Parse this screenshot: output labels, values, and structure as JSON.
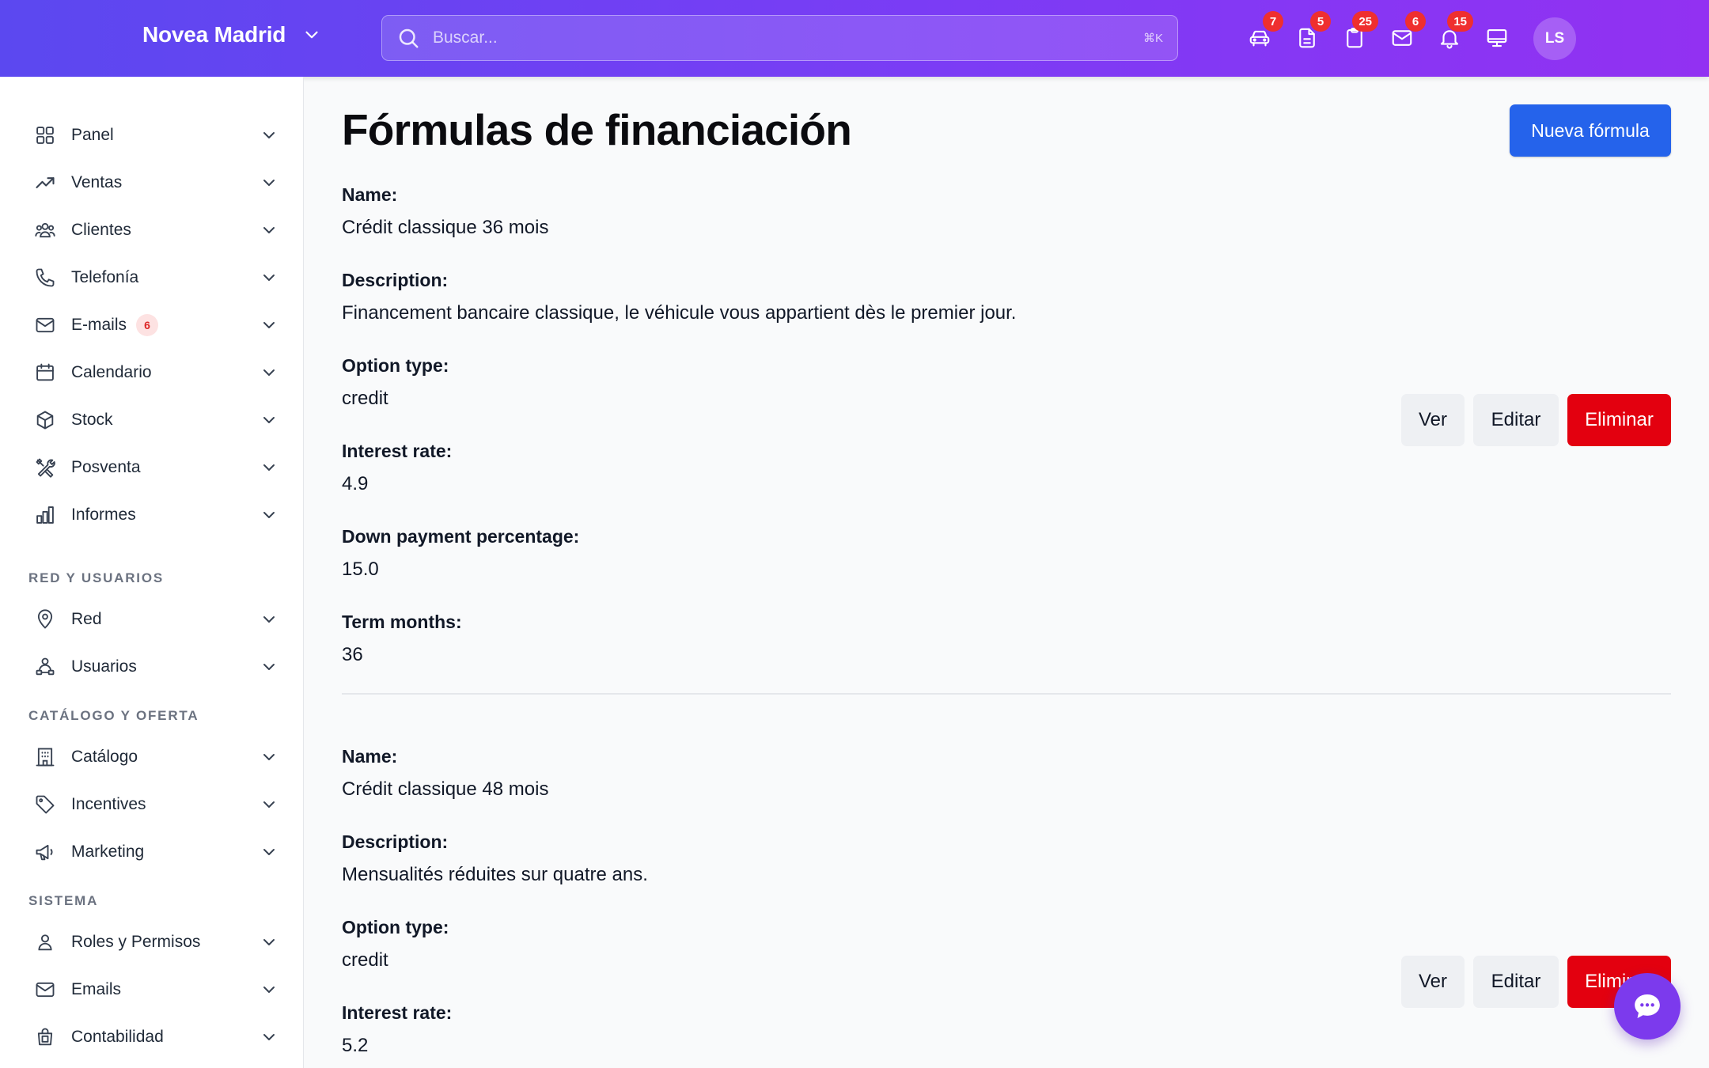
{
  "header": {
    "brand": "Novea Madrid",
    "search_placeholder": "Buscar...",
    "search_shortcut": "⌘K",
    "icons": [
      {
        "name": "car-icon",
        "badge": "7"
      },
      {
        "name": "document-icon",
        "badge": "5"
      },
      {
        "name": "clipboard-icon",
        "badge": "25"
      },
      {
        "name": "mail-icon",
        "badge": "6"
      },
      {
        "name": "bell-icon",
        "badge": "15"
      },
      {
        "name": "monitor-icon",
        "badge": ""
      }
    ],
    "avatar_initials": "LS"
  },
  "sidebar": {
    "items": [
      {
        "label": "Panel",
        "icon": "grid-icon"
      },
      {
        "label": "Ventas",
        "icon": "trending-up-icon"
      },
      {
        "label": "Clientes",
        "icon": "users-icon"
      },
      {
        "label": "Telefonía",
        "icon": "phone-icon"
      },
      {
        "label": "E-mails",
        "icon": "mail-icon",
        "badge": "6"
      },
      {
        "label": "Calendario",
        "icon": "calendar-icon"
      },
      {
        "label": "Stock",
        "icon": "box-icon"
      },
      {
        "label": "Posventa",
        "icon": "tools-icon"
      },
      {
        "label": "Informes",
        "icon": "bar-chart-icon"
      }
    ],
    "sections": [
      {
        "title": "RED Y USUARIOS",
        "items": [
          {
            "label": "Red",
            "icon": "map-pin-icon"
          },
          {
            "label": "Usuarios",
            "icon": "user-network-icon"
          }
        ]
      },
      {
        "title": "CATÁLOGO Y OFERTA",
        "items": [
          {
            "label": "Catálogo",
            "icon": "building-icon"
          },
          {
            "label": "Incentives",
            "icon": "tag-icon"
          },
          {
            "label": "Marketing",
            "icon": "megaphone-icon"
          }
        ]
      },
      {
        "title": "SISTEMA",
        "items": [
          {
            "label": "Roles y Permisos",
            "icon": "user-icon"
          },
          {
            "label": "Emails",
            "icon": "mail-icon"
          },
          {
            "label": "Contabilidad",
            "icon": "calculator-bag-icon"
          }
        ]
      }
    ]
  },
  "main": {
    "title": "Fórmulas de financiación",
    "new_button": "Nueva fórmula",
    "actions": {
      "view": "Ver",
      "edit": "Editar",
      "delete": "Eliminar"
    },
    "records": [
      {
        "fields": [
          {
            "label": "Name:",
            "value": "Crédit classique 36 mois"
          },
          {
            "label": "Description:",
            "value": "Financement bancaire classique, le véhicule vous appartient dès le premier jour."
          },
          {
            "label": "Option type:",
            "value": "credit"
          },
          {
            "label": "Interest rate:",
            "value": "4.9"
          },
          {
            "label": "Down payment percentage:",
            "value": "15.0"
          },
          {
            "label": "Term months:",
            "value": "36"
          }
        ]
      },
      {
        "fields": [
          {
            "label": "Name:",
            "value": "Crédit classique 48 mois"
          },
          {
            "label": "Description:",
            "value": "Mensualités réduites sur quatre ans."
          },
          {
            "label": "Option type:",
            "value": "credit"
          },
          {
            "label": "Interest rate:",
            "value": "5.2"
          }
        ]
      }
    ]
  },
  "colors": {
    "header_gradient_start": "#5b48f0",
    "header_gradient_end": "#9231f2",
    "primary": "#2563eb",
    "danger": "#e3000f",
    "badge": "#ef2f2f",
    "chat_fab": "#7c3aed"
  }
}
